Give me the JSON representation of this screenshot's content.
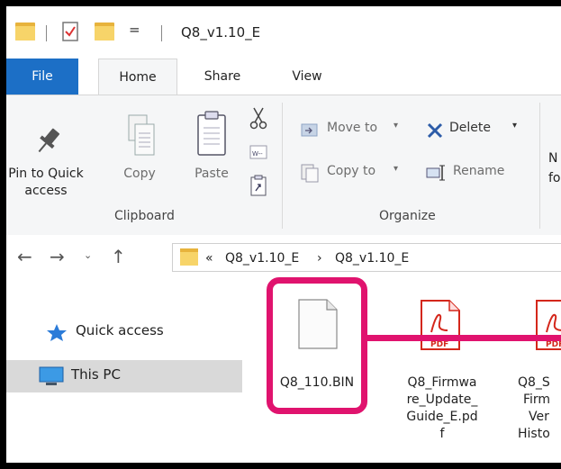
{
  "titlebar": {
    "title": "Q8_v1.10_E",
    "qat_dropdown_glyph": "="
  },
  "tabs": [
    "File",
    "Home",
    "Share",
    "View"
  ],
  "ribbon": {
    "clipboard": {
      "pin_label_line1": "Pin to Quick",
      "pin_label_line2": "access",
      "copy_label": "Copy",
      "paste_label": "Paste",
      "group_label": "Clipboard"
    },
    "organize": {
      "move_to_label": "Move to",
      "delete_label": "Delete",
      "copy_to_label": "Copy to",
      "rename_label": "Rename",
      "group_label": "Organize"
    },
    "cut_text_1": "N",
    "cut_text_2": "fo"
  },
  "address": {
    "overflow": "«",
    "crumb1": "Q8_v1.10_E",
    "sep": "›",
    "crumb2": "Q8_v1.10_E"
  },
  "nav": {
    "quick_access": "Quick access",
    "this_pc": "This PC"
  },
  "files": [
    {
      "name": "Q8_110.BIN",
      "icon": "blank-file-icon"
    },
    {
      "name_lines": [
        "Q8_Firmwa",
        "re_Update_",
        "Guide_E.pd",
        "f"
      ],
      "icon": "pdf-icon"
    },
    {
      "name_lines": [
        "Q8_S",
        "Firm",
        "Ver",
        "Histo"
      ],
      "icon": "pdf-icon"
    }
  ],
  "pdf_badge": "PDF",
  "colors": {
    "accent": "#1c6fc6",
    "highlight": "#e0136e",
    "pdf_red": "#d4271b",
    "folder": "#f7d469"
  }
}
